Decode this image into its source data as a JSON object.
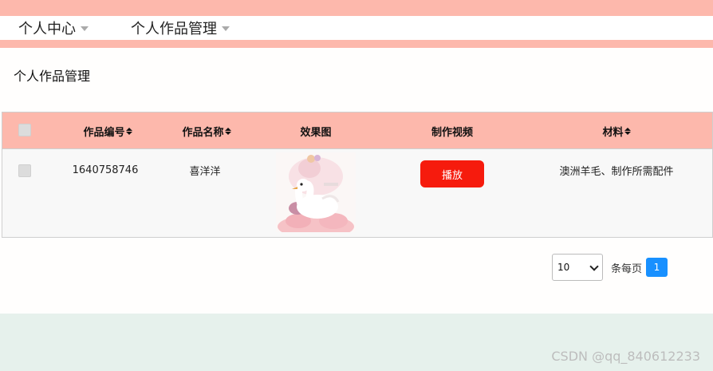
{
  "nav": {
    "items": [
      {
        "label": "个人中心"
      },
      {
        "label": "个人作品管理"
      }
    ]
  },
  "page": {
    "title": "个人作品管理"
  },
  "table": {
    "headers": {
      "id": "作品编号",
      "name": "作品名称",
      "image": "效果图",
      "video": "制作视频",
      "material": "材料"
    },
    "rows": [
      {
        "id": "1640758746",
        "name": "喜洋洋",
        "play_label": "播放",
        "material": "澳洲羊毛、制作所需配件"
      }
    ]
  },
  "pagination": {
    "page_size": "10",
    "per_page_label": "条每页",
    "current_page": "1"
  },
  "watermark": "CSDN @qq_840612233",
  "colors": {
    "header_bg": "#fdb8ac",
    "play_button": "#f61b0d",
    "page_active": "#1890ff",
    "footer_bg": "#e6f1ec"
  }
}
